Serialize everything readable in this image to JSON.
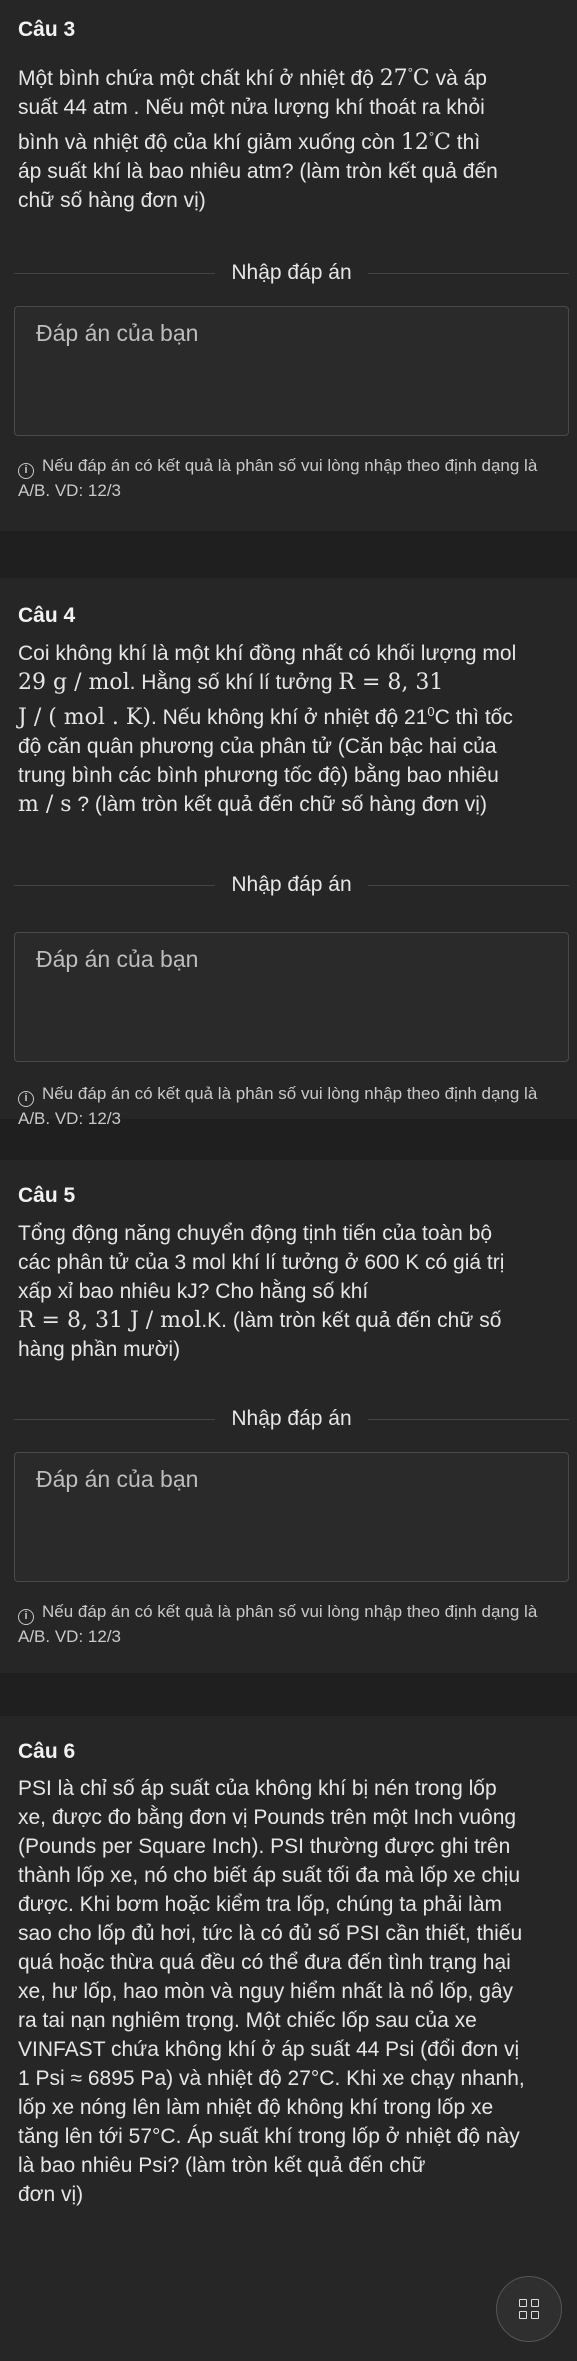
{
  "input_heading": "Nhập đáp án",
  "answer_placeholder": "Đáp án của bạn",
  "note_text": "Nếu đáp án có kết quả là phân số vui lòng nhập theo định dạng là A/B. VD: 12/3",
  "q3": {
    "title": "Câu 3",
    "l1a": "Một bình chứa một chất khí ở nhiệt độ ",
    "l1m": "27",
    "l1deg": "°",
    "l1u": "C",
    "l1b": " và áp",
    "l2": "suất 44 atm . Nếu một nửa lượng khí thoát ra khỏi",
    "l3a": "bình và nhiệt độ của khí giảm xuống còn ",
    "l3m": "12",
    "l3deg": "°",
    "l3u": "C",
    "l3b": " thì",
    "l4": "áp suất khí là bao nhiêu atm? (làm tròn kết quả đến",
    "l5": "chữ số hàng đơn vị)"
  },
  "q4": {
    "title": "Câu 4",
    "l1": "Coi không khí là một khí đồng nhất có khối lượng mol",
    "l2m": "29 g / mol",
    "l2a": ". Hằng số khí lí tưởng ",
    "l2m2": "R = 8, 31",
    "l3m": "J / ( mol . K)",
    "l3a": ". Nếu không khí ở nhiệt độ 21",
    "l3sup": "0",
    "l3b": "C thì tốc",
    "l4": "độ căn quân phương của phân tử (Căn bậc hai của",
    "l5": "trung bình các bình phương tốc độ) bằng bao nhiêu",
    "l6m": "m / s",
    "l6a": " ? (làm tròn kết quả đến chữ số hàng đơn vị)"
  },
  "q5": {
    "title": "Câu 5",
    "l1": "Tổng động năng chuyển động tịnh tiến của toàn bộ",
    "l2": "các phân tử của 3 mol khí lí tưởng ở 600 K có giá trị",
    "l3": "xấp xỉ bao nhiêu kJ? Cho hằng số khí",
    "l4m": "R = 8, 31 J / mol",
    "l4a": ".K. (làm tròn kết quả đến chữ số",
    "l5": "hàng phần mười)"
  },
  "q6": {
    "title": "Câu 6",
    "lines": [
      "PSI là chỉ số áp suất của không khí bị nén trong lốp",
      "xe, được đo bằng đơn vị Pounds trên một Inch vuông",
      "(Pounds per Square Inch). PSI thường được ghi trên",
      "thành lốp xe, nó cho biết áp suất tối đa mà lốp xe chịu",
      "được. Khi bơm hoặc kiểm tra lốp, chúng ta phải làm",
      "sao cho lốp đủ hơi, tức là có đủ số PSI cần thiết, thiếu",
      "quá hoặc thừa quá đều có thể đưa đến tình trạng hại",
      "xe, hư lốp, hao mòn và nguy hiểm nhất là nổ lốp, gây",
      "ra tai nạn nghiêm trọng. Một chiếc lốp sau của xe",
      "VINFAST chứa không khí ở áp suất 44 Psi (đổi đơn vị",
      "1 Psi ≈ 6895 Pa) và nhiệt độ 27°C. Khi xe chạy nhanh,",
      "lốp xe nóng lên làm nhiệt độ không khí trong lốp xe",
      "tăng lên tới 57°C. Áp suất khí trong lốp ở nhiệt độ này",
      "là bao nhiêu Psi? (làm tròn kết quả đến chữ",
      "đơn vị)"
    ]
  }
}
